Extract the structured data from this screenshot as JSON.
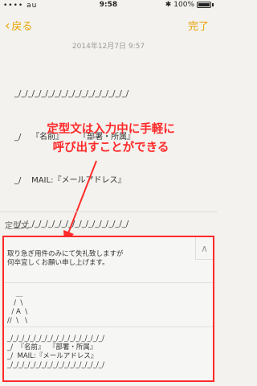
{
  "status": {
    "carrier": "•••• au",
    "time": "9:58",
    "battery": "100%"
  },
  "nav": {
    "back_label": "戻る",
    "done_label": "完了"
  },
  "date": "2014年12月7日 9:57",
  "note_lines": [
    "_/_/_/_/_/_/_/_/_/_/_/_/_/_/_/_/_/",
    "_/    『名前』      『部署・所属』",
    "_/    MAIL:『メールアドレス』",
    "_/_/_/_/_/_/_/_/_/_/_/_/_/_/_/_/_/"
  ],
  "annotation": [
    "定型文は入力中に手軽に",
    "呼び出すことができる"
  ],
  "panel": {
    "title": "定型文",
    "snippets": [
      "取り急ぎ用件のみにて失礼致しますが\n何卒宜しくお願い申し上げます。",
      "    ＿\n   /  \\\n  / A  \\\n//  \\   \\",
      "_/_/_/_/_/_/_/_/_/_/_/_/_/_/_/_/_/\n_/  『名前』  『部署・所属』\n_/  MAIL:『メールアドレス』\n_/_/_/_/_/_/_/_/_/_/_/_/_/_/_/_/_/"
    ]
  },
  "colors": {
    "accent": "#e8a300",
    "annotation": "#ff2a2a"
  },
  "icons": {
    "back": "chevron-left-icon",
    "scroll": "chevron-up-icon",
    "wifi": "wifi-icon",
    "bluetooth": "bluetooth-icon"
  }
}
